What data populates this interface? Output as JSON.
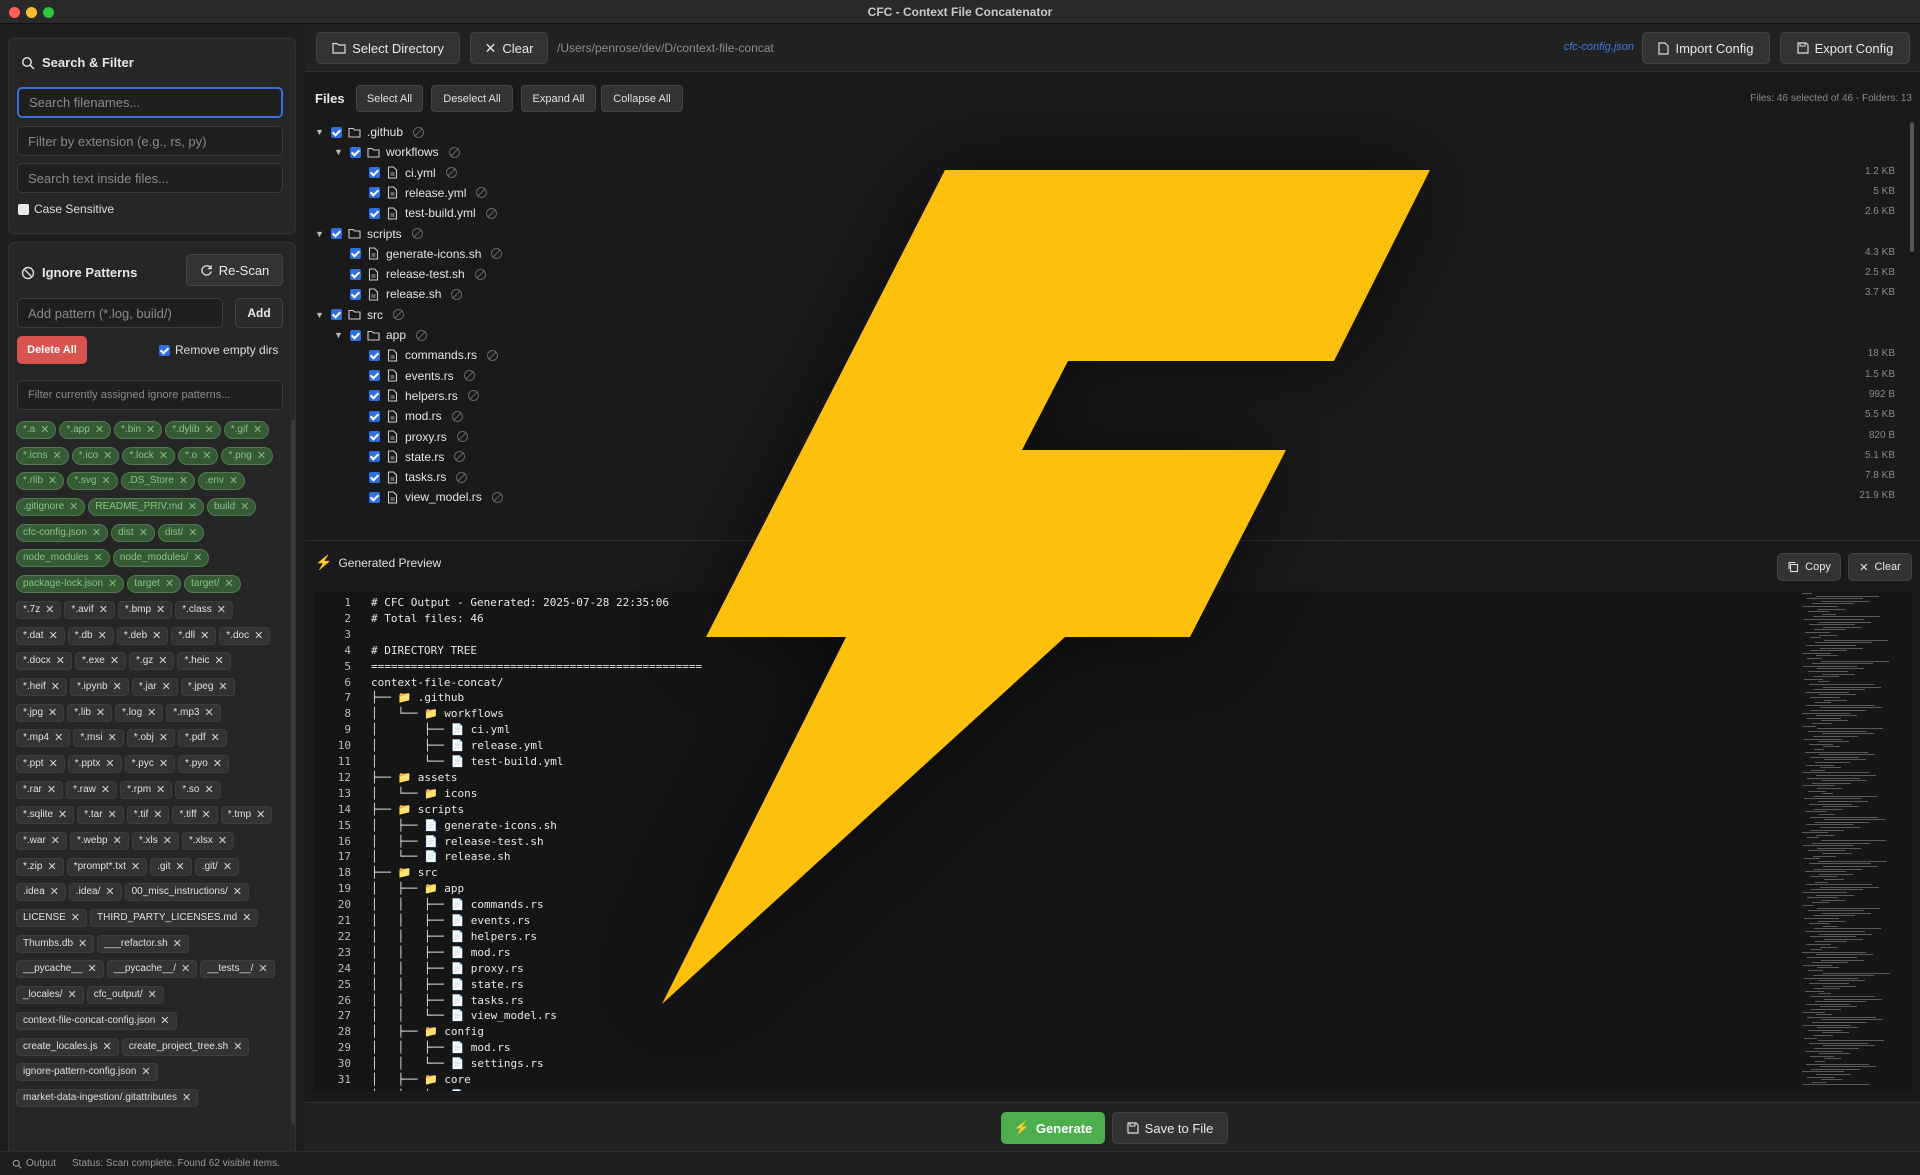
{
  "window": {
    "title": "CFC - Context File Concatenator"
  },
  "search": {
    "title": "Search & Filter",
    "filename_placeholder": "Search filenames...",
    "extension_placeholder": "Filter by extension (e.g., rs, py)",
    "content_placeholder": "Search text inside files...",
    "case_label": "Case Sensitive"
  },
  "ignore": {
    "title": "Ignore Patterns",
    "rescan_label": "Re-Scan",
    "add_placeholder": "Add pattern (*.log, build/)",
    "add_label": "Add",
    "delete_all_label": "Delete All",
    "remove_empty_label": "Remove empty dirs",
    "filter_placeholder": "Filter currently assigned ignore patterns...",
    "patterns_active": [
      "*.a",
      "*.app",
      "*.bin",
      "*.dylib",
      "*.gif",
      "*.icns",
      "*.ico",
      "*.lock",
      "*.o",
      "*.png",
      "*.rlib",
      "*.svg",
      ".DS_Store",
      ".env",
      ".gitignore",
      "README_PRIV.md",
      "build",
      "cfc-config.json",
      "dist",
      "dist/",
      "node_modules",
      "node_modules/",
      "package-lock.json",
      "target",
      "target/"
    ],
    "patterns_inactive": [
      "*.7z",
      "*.avif",
      "*.bmp",
      "*.class",
      "*.dat",
      "*.db",
      "*.deb",
      "*.dll",
      "*.doc",
      "*.docx",
      "*.exe",
      "*.gz",
      "*.heic",
      "*.heif",
      "*.ipynb",
      "*.jar",
      "*.jpeg",
      "*.jpg",
      "*.lib",
      "*.log",
      "*.mp3",
      "*.mp4",
      "*.msi",
      "*.obj",
      "*.pdf",
      "*.ppt",
      "*.pptx",
      "*.pyc",
      "*.pyo",
      "*.rar",
      "*.raw",
      "*.rpm",
      "*.so",
      "*.sqlite",
      "*.tar",
      "*.tif",
      "*.tiff",
      "*.tmp",
      "*.war",
      "*.webp",
      "*.xls",
      "*.xlsx",
      "*.zip",
      "*prompt*.txt",
      ".git",
      ".git/",
      ".idea",
      ".idea/",
      "00_misc_instructions/",
      "LICENSE",
      "THIRD_PARTY_LICENSES.md",
      "Thumbs.db",
      "___refactor.sh",
      "__pycache__",
      "__pycache__/",
      "__tests__/",
      "_locales/",
      "cfc_output/",
      "context-file-concat-config.json",
      "create_locales.js",
      "create_project_tree.sh",
      "ignore-pattern-config.json",
      "market-data-ingestion/.gitattributes"
    ]
  },
  "toolbar": {
    "select_dir_label": "Select Directory",
    "clear_label": "Clear",
    "path": "/Users/penrose/dev/D/context-file-concat",
    "config_name": "cfc-config.json",
    "import_label": "Import Config",
    "export_label": "Export Config"
  },
  "files": {
    "label": "Files",
    "select_all": "Select All",
    "deselect_all": "Deselect All",
    "expand_all": "Expand All",
    "collapse_all": "Collapse All",
    "stats": "Files: 46 selected of 46 - Folders: 13",
    "tree": [
      {
        "name": ".github",
        "type": "folder",
        "depth": 0,
        "size": ""
      },
      {
        "name": "workflows",
        "type": "folder",
        "depth": 1,
        "size": ""
      },
      {
        "name": "ci.yml",
        "type": "file",
        "depth": 2,
        "size": "1.2 KB"
      },
      {
        "name": "release.yml",
        "type": "file",
        "depth": 2,
        "size": "5 KB"
      },
      {
        "name": "test-build.yml",
        "type": "file",
        "depth": 2,
        "size": "2.6 KB"
      },
      {
        "name": "scripts",
        "type": "folder",
        "depth": 0,
        "size": ""
      },
      {
        "name": "generate-icons.sh",
        "type": "file",
        "depth": 1,
        "size": "4.3 KB"
      },
      {
        "name": "release-test.sh",
        "type": "file",
        "depth": 1,
        "size": "2.5 KB"
      },
      {
        "name": "release.sh",
        "type": "file",
        "depth": 1,
        "size": "3.7 KB"
      },
      {
        "name": "src",
        "type": "folder",
        "depth": 0,
        "size": ""
      },
      {
        "name": "app",
        "type": "folder",
        "depth": 1,
        "size": ""
      },
      {
        "name": "commands.rs",
        "type": "file",
        "depth": 2,
        "size": "18 KB"
      },
      {
        "name": "events.rs",
        "type": "file",
        "depth": 2,
        "size": "1.5 KB"
      },
      {
        "name": "helpers.rs",
        "type": "file",
        "depth": 2,
        "size": "992 B"
      },
      {
        "name": "mod.rs",
        "type": "file",
        "depth": 2,
        "size": "5.5 KB"
      },
      {
        "name": "proxy.rs",
        "type": "file",
        "depth": 2,
        "size": "820 B"
      },
      {
        "name": "state.rs",
        "type": "file",
        "depth": 2,
        "size": "5.1 KB"
      },
      {
        "name": "tasks.rs",
        "type": "file",
        "depth": 2,
        "size": "7.8 KB"
      },
      {
        "name": "view_model.rs",
        "type": "file",
        "depth": 2,
        "size": "21.9 KB"
      }
    ]
  },
  "preview": {
    "title": "Generated Preview",
    "copy_label": "Copy",
    "clear_label": "Clear",
    "lines": [
      "# CFC Output - Generated: 2025-07-28 22:35:06",
      "# Total files: 46",
      "",
      "# DIRECTORY TREE",
      "==================================================",
      "context-file-concat/",
      "├── 📁 .github",
      "│   └── 📁 workflows",
      "│       ├── 📄 ci.yml",
      "│       ├── 📄 release.yml",
      "│       └── 📄 test-build.yml",
      "├── 📁 assets",
      "│   └── 📁 icons",
      "├── 📁 scripts",
      "│   ├── 📄 generate-icons.sh",
      "│   ├── 📄 release-test.sh",
      "│   └── 📄 release.sh",
      "├── 📁 src",
      "│   ├── 📁 app",
      "│   │   ├── 📄 commands.rs",
      "│   │   ├── 📄 events.rs",
      "│   │   ├── 📄 helpers.rs",
      "│   │   ├── 📄 mod.rs",
      "│   │   ├── 📄 proxy.rs",
      "│   │   ├── 📄 state.rs",
      "│   │   ├── 📄 tasks.rs",
      "│   │   └── 📄 view_model.rs",
      "│   ├── 📁 config",
      "│   │   ├── 📄 mod.rs",
      "│   │   └── 📄 settings.rs",
      "│   ├── 📁 core",
      "│   │   └── 📄 error.rs"
    ]
  },
  "actions": {
    "generate_label": "Generate",
    "save_label": "Save to File"
  },
  "status": {
    "output_label": "Output",
    "text": "Status: Scan complete. Found 62 visible items."
  },
  "colors": {
    "accent": "#3b6fd6",
    "danger": "#d9534f",
    "success": "#4cae4c",
    "bolt": "#fcc00d"
  }
}
